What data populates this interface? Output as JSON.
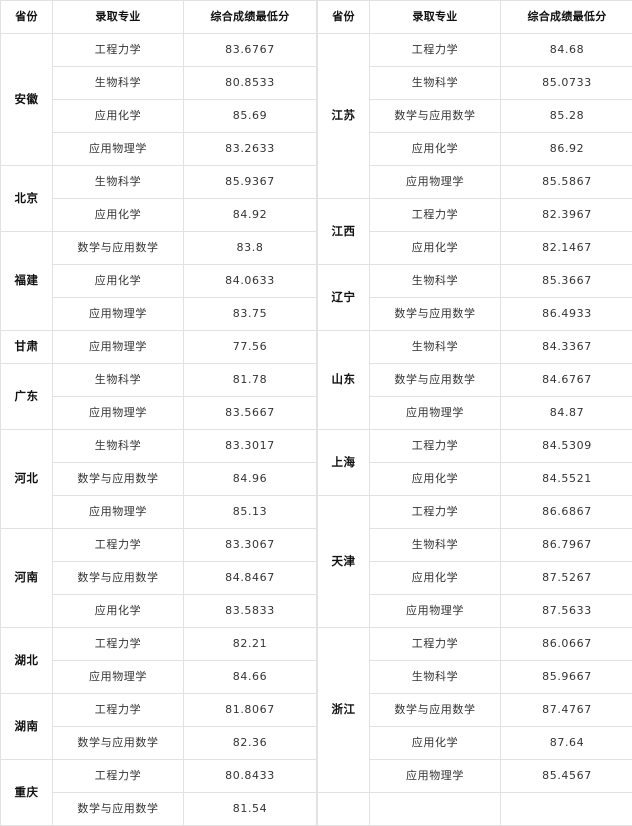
{
  "headers": {
    "province": "省份",
    "major": "录取专业",
    "score": "综合成绩最低分"
  },
  "left_table": {
    "groups": [
      {
        "province": "安徽",
        "rows": [
          {
            "major": "工程力学",
            "score": "83.6767"
          },
          {
            "major": "生物科学",
            "score": "80.8533"
          },
          {
            "major": "应用化学",
            "score": "85.69"
          },
          {
            "major": "应用物理学",
            "score": "83.2633"
          }
        ]
      },
      {
        "province": "北京",
        "rows": [
          {
            "major": "生物科学",
            "score": "85.9367"
          },
          {
            "major": "应用化学",
            "score": "84.92"
          }
        ]
      },
      {
        "province": "福建",
        "rows": [
          {
            "major": "数学与应用数学",
            "score": "83.8"
          },
          {
            "major": "应用化学",
            "score": "84.0633"
          },
          {
            "major": "应用物理学",
            "score": "83.75"
          }
        ]
      },
      {
        "province": "甘肃",
        "rows": [
          {
            "major": "应用物理学",
            "score": "77.56"
          }
        ]
      },
      {
        "province": "广东",
        "rows": [
          {
            "major": "生物科学",
            "score": "81.78"
          },
          {
            "major": "应用物理学",
            "score": "83.5667"
          }
        ]
      },
      {
        "province": "河北",
        "rows": [
          {
            "major": "生物科学",
            "score": "83.3017"
          },
          {
            "major": "数学与应用数学",
            "score": "84.96"
          },
          {
            "major": "应用物理学",
            "score": "85.13"
          }
        ]
      },
      {
        "province": "河南",
        "rows": [
          {
            "major": "工程力学",
            "score": "83.3067"
          },
          {
            "major": "数学与应用数学",
            "score": "84.8467"
          },
          {
            "major": "应用化学",
            "score": "83.5833"
          }
        ]
      },
      {
        "province": "湖北",
        "rows": [
          {
            "major": "工程力学",
            "score": "82.21"
          },
          {
            "major": "应用物理学",
            "score": "84.66"
          }
        ]
      },
      {
        "province": "湖南",
        "rows": [
          {
            "major": "工程力学",
            "score": "81.8067"
          },
          {
            "major": "数学与应用数学",
            "score": "82.36"
          }
        ]
      },
      {
        "province": "重庆",
        "rows": [
          {
            "major": "工程力学",
            "score": "80.8433"
          },
          {
            "major": "数学与应用数学",
            "score": "81.54"
          }
        ]
      }
    ]
  },
  "right_table": {
    "groups": [
      {
        "province": "江苏",
        "rows": [
          {
            "major": "工程力学",
            "score": "84.68"
          },
          {
            "major": "生物科学",
            "score": "85.0733"
          },
          {
            "major": "数学与应用数学",
            "score": "85.28"
          },
          {
            "major": "应用化学",
            "score": "86.92"
          },
          {
            "major": "应用物理学",
            "score": "85.5867"
          }
        ]
      },
      {
        "province": "江西",
        "rows": [
          {
            "major": "工程力学",
            "score": "82.3967"
          },
          {
            "major": "应用化学",
            "score": "82.1467"
          }
        ]
      },
      {
        "province": "辽宁",
        "rows": [
          {
            "major": "生物科学",
            "score": "85.3667"
          },
          {
            "major": "数学与应用数学",
            "score": "86.4933"
          }
        ]
      },
      {
        "province": "山东",
        "rows": [
          {
            "major": "生物科学",
            "score": "84.3367"
          },
          {
            "major": "数学与应用数学",
            "score": "84.6767"
          },
          {
            "major": "应用物理学",
            "score": "84.87"
          }
        ]
      },
      {
        "province": "上海",
        "rows": [
          {
            "major": "工程力学",
            "score": "84.5309"
          },
          {
            "major": "应用化学",
            "score": "84.5521"
          }
        ]
      },
      {
        "province": "天津",
        "rows": [
          {
            "major": "工程力学",
            "score": "86.6867"
          },
          {
            "major": "生物科学",
            "score": "86.7967"
          },
          {
            "major": "应用化学",
            "score": "87.5267"
          },
          {
            "major": "应用物理学",
            "score": "87.5633"
          }
        ]
      },
      {
        "province": "浙江",
        "rows": [
          {
            "major": "工程力学",
            "score": "86.0667"
          },
          {
            "major": "生物科学",
            "score": "85.9667"
          },
          {
            "major": "数学与应用数学",
            "score": "87.4767"
          },
          {
            "major": "应用化学",
            "score": "87.64"
          },
          {
            "major": "应用物理学",
            "score": "85.4567"
          }
        ]
      }
    ]
  }
}
